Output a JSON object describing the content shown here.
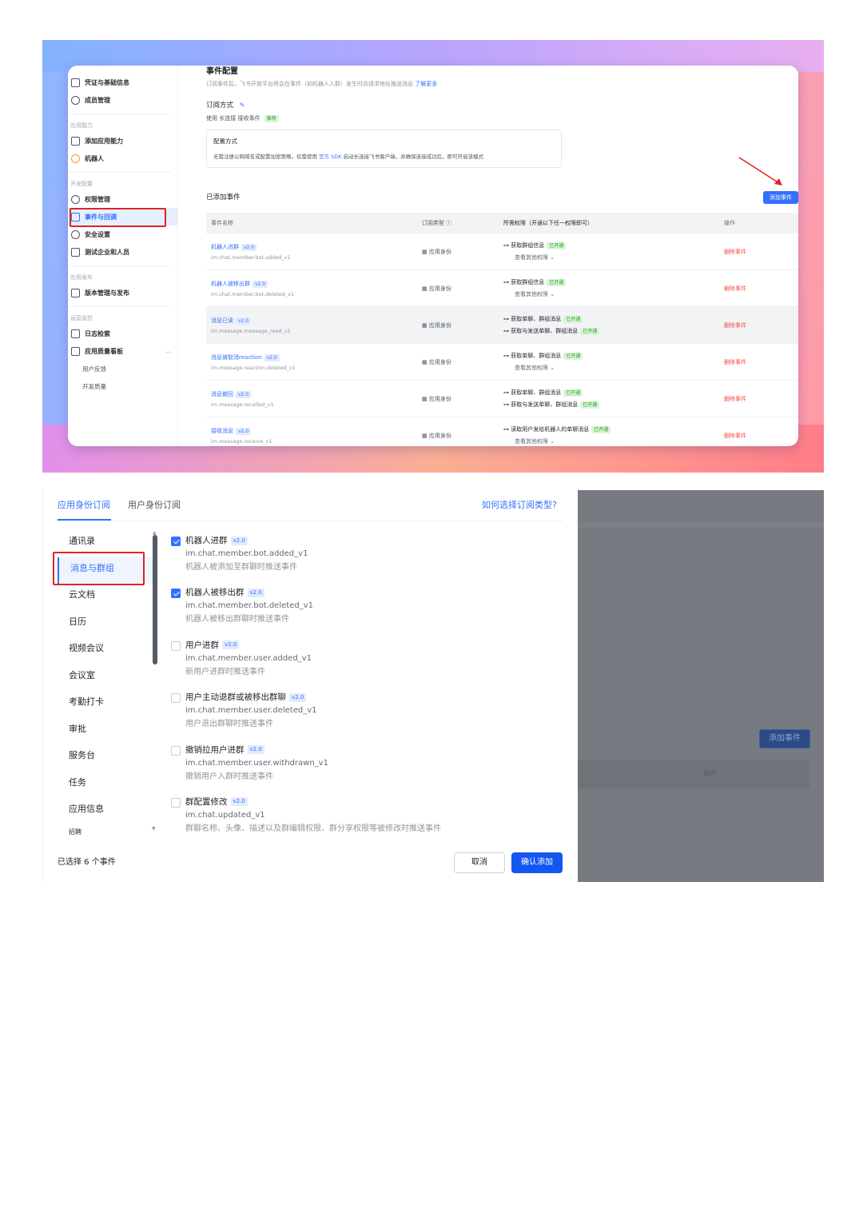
{
  "screen1": {
    "sidebar": {
      "items_top": [
        {
          "label": "凭证与基础信息",
          "icon": "document-icon"
        },
        {
          "label": "成员管理",
          "icon": "user-icon"
        }
      ],
      "section_app": "应用能力",
      "items_app": [
        {
          "label": "添加应用能力",
          "icon": "grid-icon"
        },
        {
          "label": "机器人",
          "icon": "robot-icon"
        }
      ],
      "section_dev": "开发配置",
      "items_dev": [
        {
          "label": "权限管理",
          "icon": "lock-icon"
        },
        {
          "label": "事件与回调",
          "icon": "event-icon"
        },
        {
          "label": "安全设置",
          "icon": "shield-icon"
        },
        {
          "label": "测试企业和人员",
          "icon": "test-icon"
        }
      ],
      "section_release": "应用发布",
      "items_release": [
        {
          "label": "版本管理与发布",
          "icon": "version-icon"
        }
      ],
      "section_ops": "运营监控",
      "items_ops": [
        {
          "label": "日志检索",
          "icon": "log-icon"
        },
        {
          "label": "应用质量看板",
          "icon": "chart-icon"
        }
      ],
      "items_ops_sub": [
        "用户反馈",
        "开发质量"
      ]
    },
    "main": {
      "title": "事件配置",
      "description": "订阅事件后，飞书开放平台将会在事件（如机器人入群）发生时向请求地址推送消息",
      "learn_more": "了解更多",
      "subscribe_label": "订阅方式",
      "mode_text": "使用 长连接 接收事件",
      "mode_tag": "推荐",
      "config_title": "配置方式",
      "config_desc_a": "无需注册公网域名或配置加密策略，仅需使用",
      "config_desc_link": "官方 SDK",
      "config_desc_b": "启动长连接飞书客户端，并确保连接成功后，即可开启该模式",
      "added_title": "已添加事件",
      "add_button": "添加事件",
      "table_headers": {
        "name": "事件名称",
        "type": "订阅类型 ⓘ",
        "perm": "所需权限（开通以下任一权限即可）",
        "op": "操作"
      },
      "rows": [
        {
          "name": "机器人进群",
          "version": "v2.0",
          "key": "im.chat.member.bot.added_v1",
          "type": "应用身份",
          "perms": [
            {
              "text": "获取群组信息",
              "tag": "已开通"
            }
          ],
          "more": "查看其他权限"
        },
        {
          "name": "机器人被移出群",
          "version": "v2.0",
          "key": "im.chat.member.bot.deleted_v1",
          "type": "应用身份",
          "perms": [
            {
              "text": "获取群组信息",
              "tag": "已开通"
            }
          ],
          "more": "查看其他权限"
        },
        {
          "name": "消息已读",
          "version": "v2.0",
          "key": "im.message.message_read_v1",
          "type": "应用身份",
          "perms": [
            {
              "text": "获取单聊、群组消息",
              "tag": "已开通"
            },
            {
              "text": "获取与发送单聊、群组消息",
              "tag": "已开通"
            }
          ],
          "more": ""
        },
        {
          "name": "消息被取消reaction",
          "version": "v2.0",
          "key": "im.message.reaction.deleted_v1",
          "type": "应用身份",
          "perms": [
            {
              "text": "获取单聊、群组消息",
              "tag": "已开通"
            }
          ],
          "more": "查看其他权限"
        },
        {
          "name": "消息撤回",
          "version": "v2.0",
          "key": "im.message.recalled_v1",
          "type": "应用身份",
          "perms": [
            {
              "text": "获取单聊、群组消息",
              "tag": "已开通"
            },
            {
              "text": "获取与发送单聊、群组消息",
              "tag": "已开通"
            }
          ],
          "more": ""
        },
        {
          "name": "接收消息",
          "version": "v2.0",
          "key": "im.message.receive_v1",
          "type": "应用身份",
          "perms": [
            {
              "text": "读取用户发给机器人的单聊消息",
              "tag": "已开通"
            }
          ],
          "more": "查看其他权限"
        }
      ],
      "delete_label": "删除事件"
    }
  },
  "screen2": {
    "tabs": [
      "应用身份订阅",
      "用户身份订阅"
    ],
    "help_link": "如何选择订阅类型?",
    "categories": [
      "通讯录",
      "消息与群组",
      "云文档",
      "日历",
      "视频会议",
      "会议室",
      "考勤打卡",
      "审批",
      "服务台",
      "任务",
      "应用信息",
      "招聘"
    ],
    "active_category": "消息与群组",
    "events": [
      {
        "title": "机器人进群",
        "version": "v2.0",
        "key": "im.chat.member.bot.added_v1",
        "desc": "机器人被添加至群聊时推送事件",
        "checked": true
      },
      {
        "title": "机器人被移出群",
        "version": "v2.0",
        "key": "im.chat.member.bot.deleted_v1",
        "desc": "机器人被移出群聊时推送事件",
        "checked": true
      },
      {
        "title": "用户进群",
        "version": "v2.0",
        "key": "im.chat.member.user.added_v1",
        "desc": "新用户进群时推送事件",
        "checked": false
      },
      {
        "title": "用户主动退群或被移出群聊",
        "version": "v2.0",
        "key": "im.chat.member.user.deleted_v1",
        "desc": "用户退出群聊时推送事件",
        "checked": false
      },
      {
        "title": "撤销拉用户进群",
        "version": "v2.0",
        "key": "im.chat.member.user.withdrawn_v1",
        "desc": "撤销用户入群时推送事件",
        "checked": false
      },
      {
        "title": "群配置修改",
        "version": "v2.0",
        "key": "im.chat.updated_v1",
        "desc": "群聊名称、头像、描述以及群编辑权限、群分享权限等被修改时推送事件",
        "checked": false
      }
    ],
    "selected_count": "已选择 6 个事件",
    "cancel_button": "取消",
    "confirm_button": "确认添加",
    "overlay_add_button": "添加事件",
    "overlay_op_label": "操作"
  },
  "colors": {
    "primary": "#3370ff",
    "highlight_box": "#e02424",
    "delete": "#f54a45",
    "tag_green": "#2ea121"
  }
}
